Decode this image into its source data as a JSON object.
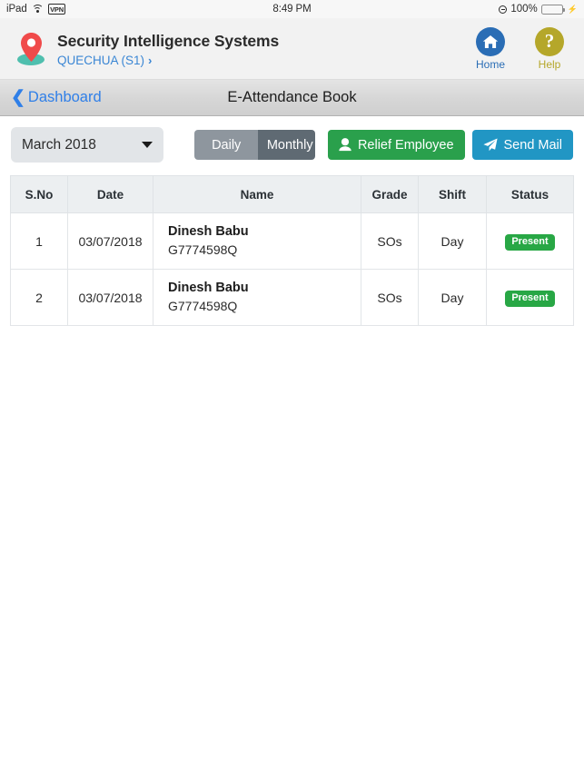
{
  "status_bar": {
    "device": "iPad",
    "wifi_icon": "wifi-icon",
    "vpn_label": "VPN",
    "time": "8:49 PM",
    "location_icon": "location-arrow-icon",
    "battery_percent": "100%",
    "battery_level": 100,
    "charging": true
  },
  "header": {
    "logo_icon": "map-pin-logo",
    "title": "Security Intelligence Systems",
    "site": "QUECHUA (S1)",
    "site_chevron": "›",
    "actions": [
      {
        "label": "Home",
        "icon": "home-icon",
        "color": "#2a6db5"
      },
      {
        "label": "Help",
        "icon": "question-mark-icon",
        "color": "#b5a72a"
      }
    ]
  },
  "navbar": {
    "back_icon": "chevron-left-icon",
    "back_label": "Dashboard",
    "title": "E-Attendance Book"
  },
  "toolbar": {
    "month_value": "March 2018",
    "month_caret_icon": "caret-down-icon",
    "segments": [
      {
        "label": "Daily",
        "active": false
      },
      {
        "label": "Monthly",
        "active": true
      }
    ],
    "relief_button": {
      "label": "Relief Employee",
      "icon": "user-icon",
      "color": "#2aa04c"
    },
    "mail_button": {
      "label": "Send Mail",
      "icon": "paper-plane-icon",
      "color": "#2196c4"
    }
  },
  "table": {
    "columns": [
      "S.No",
      "Date",
      "Name",
      "Grade",
      "Shift",
      "Status"
    ],
    "rows": [
      {
        "sno": "1",
        "date": "03/07/2018",
        "name": "Dinesh Babu",
        "employee_id": "G7774598Q",
        "grade": "SOs",
        "shift": "Day",
        "status": "Present",
        "status_color": "#28a745"
      },
      {
        "sno": "2",
        "date": "03/07/2018",
        "name": "Dinesh Babu",
        "employee_id": "G7774598Q",
        "grade": "SOs",
        "shift": "Day",
        "status": "Present",
        "status_color": "#28a745"
      }
    ]
  }
}
